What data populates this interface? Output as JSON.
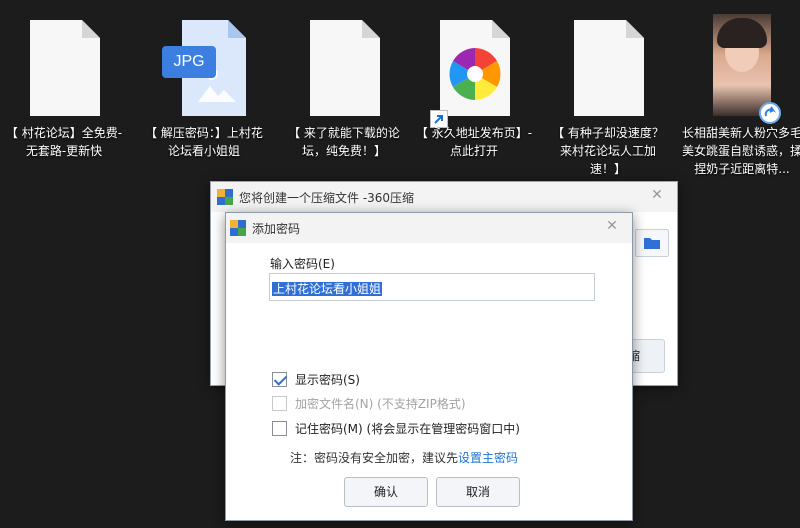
{
  "desktop": {
    "icons": [
      {
        "label": "【 村花论坛】全免费-无套路-更新快",
        "icon": "document-icon"
      },
      {
        "label": "【 解压密码：】上村花论坛看小姐姐",
        "icon": "jpg-image-icon",
        "badge": "JPG"
      },
      {
        "label": "【 来了就能下载的论坛，纯免费！】",
        "icon": "document-icon"
      },
      {
        "label": "【 永久地址发布页】-点此打开",
        "icon": "browser-shortcut-icon"
      },
      {
        "label": "【 有种子却没速度？来村花论坛人工加速！】",
        "icon": "document-icon"
      },
      {
        "label": "长相甜美新人粉穴多毛美女跳蛋自慰诱惑，揉捏奶子近距离特...",
        "icon": "video-thumbnail-icon"
      }
    ]
  },
  "back_window": {
    "title": "您将创建一个压缩文件 -360压缩",
    "close_glyph": "✕",
    "partial_button_label": "缩"
  },
  "dialog": {
    "title": "添加密码",
    "close_glyph": "✕",
    "password_label": "输入密码(E)",
    "password_value": "上村花论坛看小姐姐",
    "options": {
      "show_password": {
        "label": "显示密码(S)",
        "checked": true
      },
      "encrypt_filenames": {
        "label": "加密文件名(N) (不支持ZIP格式)",
        "checked": false,
        "disabled": true
      },
      "remember_password": {
        "label": "记住密码(M) (将会显示在管理密码窗口中)",
        "checked": false
      }
    },
    "note_prefix": "注：密码没有安全加密，建议先",
    "note_link": "设置主密码",
    "ok_label": "确认",
    "cancel_label": "取消"
  },
  "colors": {
    "desktop_bg": "#1c1c1c",
    "selection": "#2f6fd6",
    "link": "#1b74d6"
  }
}
